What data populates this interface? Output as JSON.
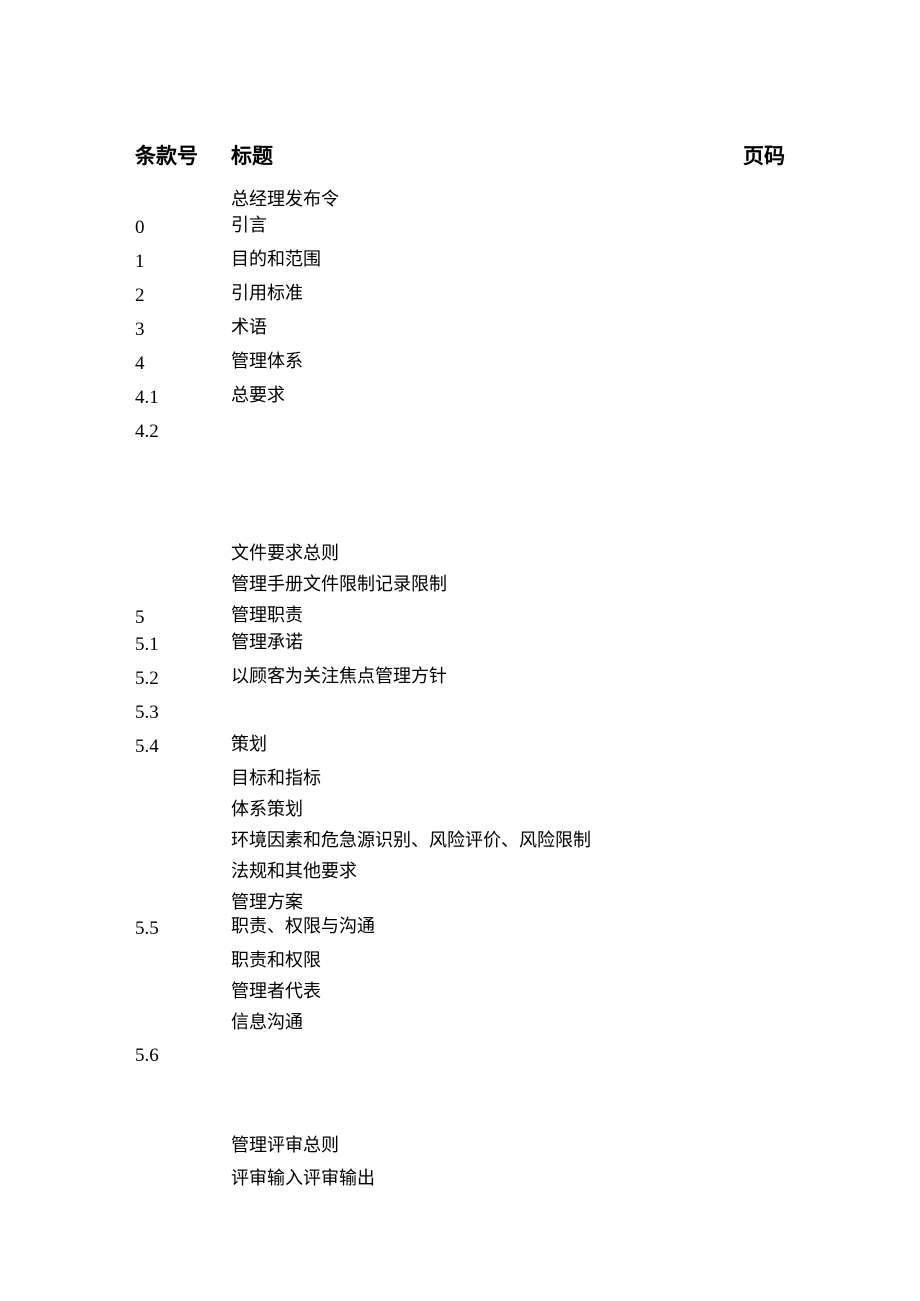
{
  "headers": {
    "clause_no": "条款号",
    "title": "标题",
    "page_no": "页码"
  },
  "block1": [
    {
      "num": "",
      "title": "总经理发布令"
    },
    {
      "num": "0",
      "title": "引言"
    },
    {
      "num": "1",
      "title": "目的和范围"
    },
    {
      "num": "2",
      "title": "引用标准"
    },
    {
      "num": "3",
      "title": "术语"
    },
    {
      "num": "4",
      "title": "管理体系"
    },
    {
      "num": "4.1",
      "title": "总要求"
    },
    {
      "num": "4.2",
      "title": ""
    }
  ],
  "block2": [
    {
      "num": "",
      "title": "文件要求总则"
    },
    {
      "num": "",
      "title": "管理手册文件限制记录限制"
    },
    {
      "num": "5",
      "title": "管理职责"
    },
    {
      "num": "5.1",
      "title": "管理承诺"
    },
    {
      "num": "5.2",
      "title": "以顾客为关注焦点管理方针"
    },
    {
      "num": "5.3",
      "title": ""
    },
    {
      "num": "5.4",
      "title": "策划"
    },
    {
      "num": "",
      "title": "目标和指标"
    },
    {
      "num": "",
      "title": "体系策划"
    },
    {
      "num": "",
      "title": "环境因素和危急源识别、风险评价、风险限制"
    },
    {
      "num": "",
      "title": "法规和其他要求"
    },
    {
      "num": "",
      "title": "管理方案",
      "tight": true
    },
    {
      "num": "5.5",
      "title": "职责、权限与沟通"
    },
    {
      "num": "",
      "title": "职责和权限"
    },
    {
      "num": "",
      "title": "管理者代表"
    },
    {
      "num": "",
      "title": "信息沟通"
    },
    {
      "num": "5.6",
      "title": ""
    }
  ],
  "block3": [
    {
      "num": "",
      "title": "管理评审总则"
    },
    {
      "num": "",
      "title": "评审输入评审输出"
    }
  ]
}
